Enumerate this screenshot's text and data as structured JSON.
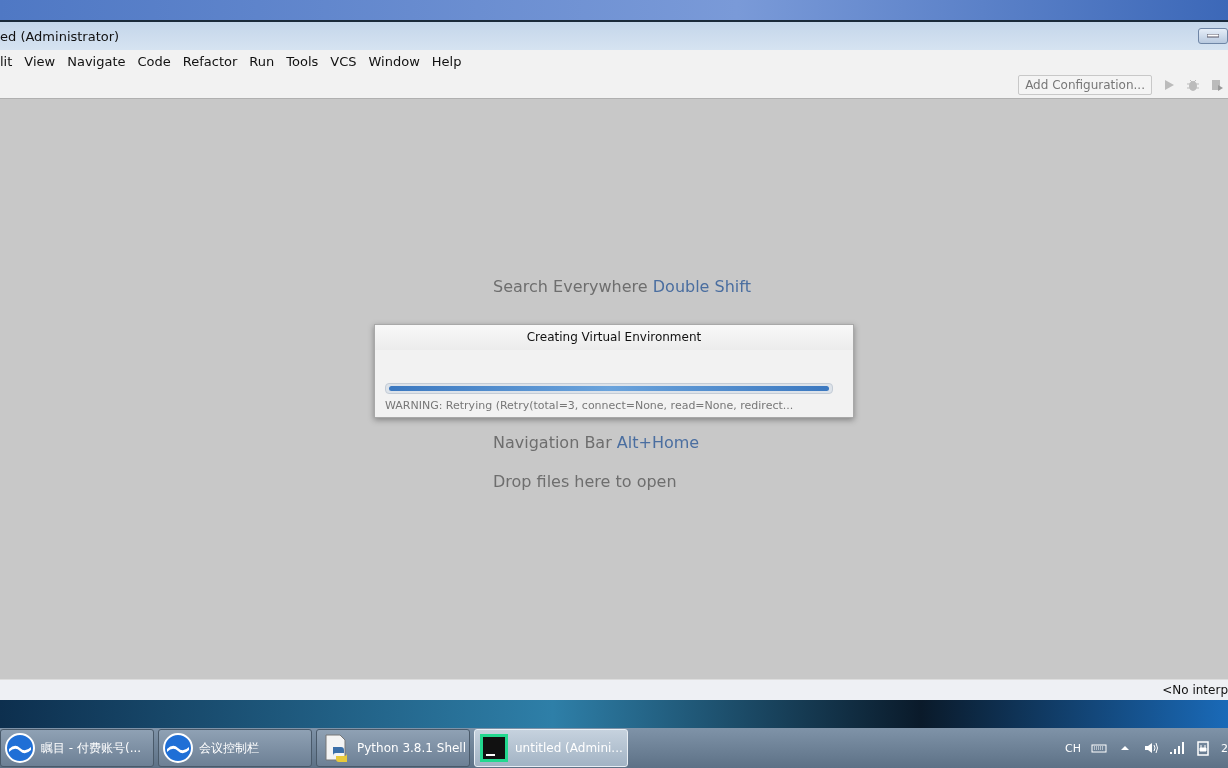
{
  "window": {
    "title": "ed (Administrator)"
  },
  "menu": [
    {
      "label": "lit"
    },
    {
      "label": "View"
    },
    {
      "label": "Navigate"
    },
    {
      "label": "Code"
    },
    {
      "label": "Refactor"
    },
    {
      "label": "Run"
    },
    {
      "label": "Tools"
    },
    {
      "label": "VCS"
    },
    {
      "label": "Window"
    },
    {
      "label": "Help"
    }
  ],
  "toolbar": {
    "config_button": "Add Configuration..."
  },
  "hints": [
    {
      "action": "Search Everywhere",
      "shortcut": "Double Shift"
    },
    {
      "action": "Navigation Bar",
      "shortcut": "Alt+Home"
    },
    {
      "action": "Drop files here to open"
    }
  ],
  "dialog": {
    "title": "Creating Virtual Environment",
    "level": 1,
    "message": "WARNING: Retrying (Retry(total=3, connect=None, read=None, redirect..."
  },
  "status_bar": {
    "interpreter": "<No interp"
  },
  "taskbar": {
    "items": [
      {
        "kind": "meeting",
        "label": "瞩目 - 付费账号(...",
        "selected": false
      },
      {
        "kind": "meeting",
        "label": "会议控制栏",
        "selected": false
      },
      {
        "kind": "python",
        "label": "Python 3.8.1 Shell",
        "selected": false
      },
      {
        "kind": "pycharm",
        "label": "untitled (Admini...",
        "selected": true
      }
    ],
    "tray": {
      "language": "CH",
      "clock": "2"
    }
  }
}
